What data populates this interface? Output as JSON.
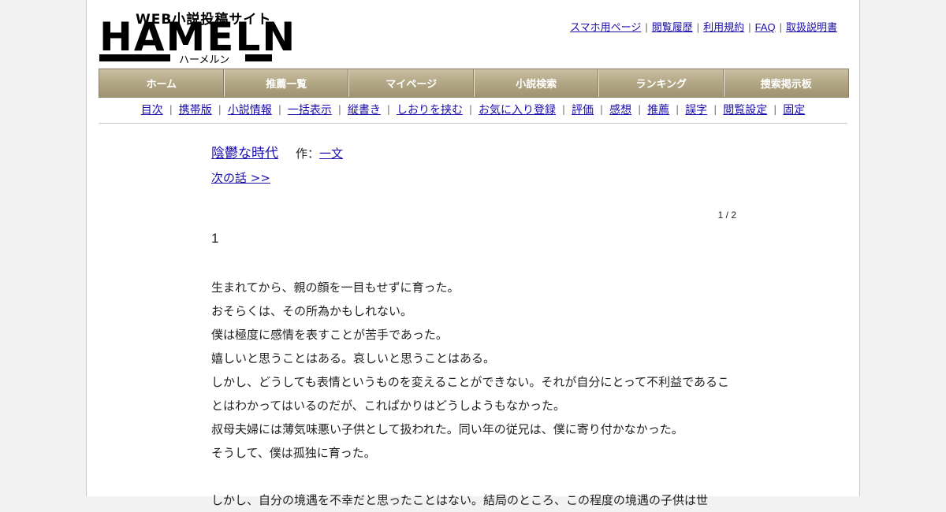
{
  "logo": {
    "sub": "WEB小説投稿サイト",
    "main": "HAMELN",
    "kana": "ハーメルン"
  },
  "top_links": [
    "スマホ用ページ",
    "閲覧履歴",
    "利用規約",
    "FAQ",
    "取扱説明書"
  ],
  "nav": [
    "ホーム",
    "推薦一覧",
    "マイページ",
    "小説検索",
    "ランキング",
    "捜索掲示板"
  ],
  "subnav": [
    "目次",
    "携帯版",
    "小説情報",
    "一括表示",
    "縦書き",
    "しおりを挟む",
    "お気に入り登録",
    "評価",
    "感想",
    "推薦",
    "誤字",
    "閲覧設定",
    "固定"
  ],
  "novel": {
    "title": "陰鬱な時代",
    "author_prefix": "作：",
    "author": "一文",
    "next_link": "次の話 >>",
    "page_count": "1 / 2",
    "chapter_number": "1",
    "paragraphs": [
      "生まれてから、親の顔を一目もせずに育った。",
      "おそらくは、その所為かもしれない。",
      "僕は極度に感情を表すことが苦手であった。",
      "嬉しいと思うことはある。哀しいと思うことはある。",
      "しかし、どうしても表情というものを変えることができない。それが自分にとって不利益であるこ",
      "とはわかってはいるのだが、これぱかりはどうしようもなかった。",
      "叔母夫婦には薄気味悪い子供として扱われた。同い年の従兄は、僕に寄り付かなかった。",
      "そうして、僕は孤独に育った。"
    ],
    "next_paragraph": "しかし、自分の境遇を不幸だと思ったことはない。結局のところ、この程度の境遇の子供は世"
  }
}
